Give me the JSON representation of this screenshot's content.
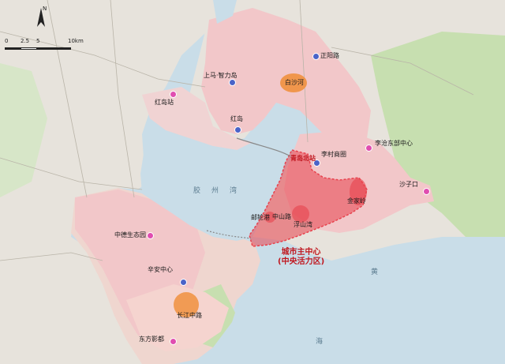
{
  "scale": {
    "t0": "0",
    "t1": "2.5",
    "t2": "5",
    "t3": "10km"
  },
  "north_label": "N",
  "bay_name": "胶州湾",
  "sea_char": "黄",
  "sea_char2": "海",
  "labels": {
    "zhenyang": "正阳路",
    "baisha": "白沙河",
    "shangma": "上马·智力岛",
    "hongdaozhan": "红岛站",
    "hongdao": "红岛",
    "licun": "李村商圈",
    "licun_east": "李沧东部中心",
    "qingdaobei": "青岛北站",
    "shazikou": "沙子口",
    "jinjialing": "金家岭",
    "youlun": "邮轮港",
    "zhongshan": "中山路",
    "fushan": "浮山湾",
    "zhongde": "中德生态园",
    "xinan": "辛安中心",
    "changjiang": "长江中路",
    "dongfang": "东方影都"
  },
  "core_title_line1": "城市主中心",
  "core_title_line2": "(中央活力区)",
  "colors": {
    "sea": "#c9dde8",
    "land_base": "#e7e3dc",
    "urban": "#f2c7c9",
    "green": "#c7dfb0",
    "core_red": "#e8424d",
    "orange": "#f0903e",
    "blue_dot": "#4a63c8",
    "pink_dot": "#e04db0"
  }
}
